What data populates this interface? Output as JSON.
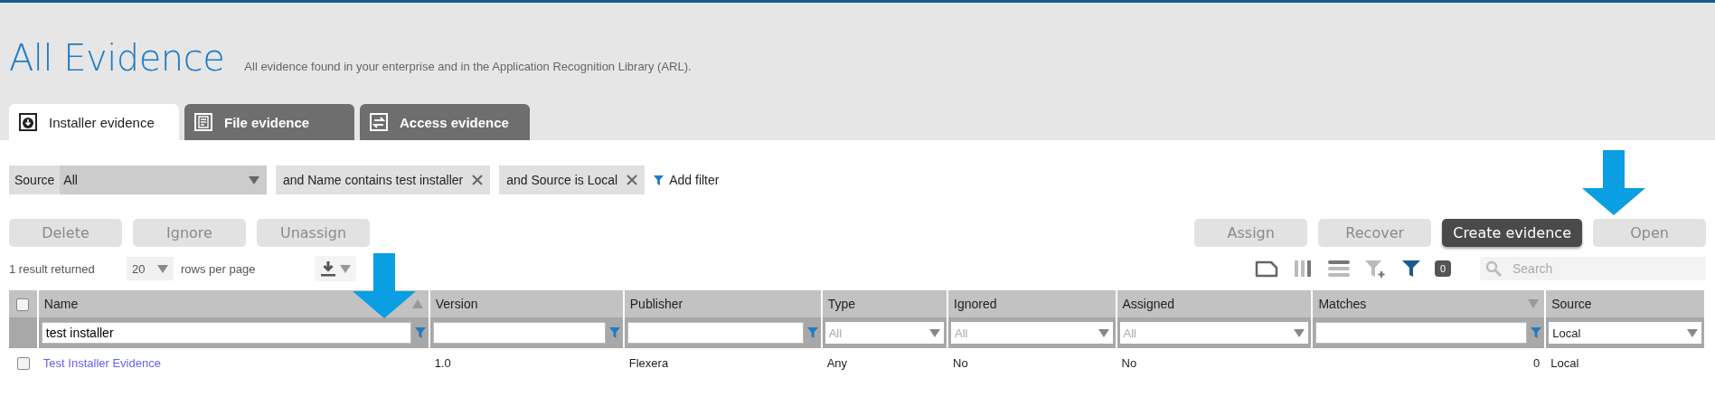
{
  "page": {
    "title": "All Evidence",
    "subtitle": "All evidence found in your enterprise and in the Application Recognition Library (ARL)."
  },
  "tabs": [
    {
      "label": "Installer evidence",
      "selected": true
    },
    {
      "label": "File evidence",
      "selected": false
    },
    {
      "label": "Access evidence",
      "selected": false
    }
  ],
  "filters": {
    "source_label": "Source",
    "source_value": "All",
    "chips": [
      "and Name contains test installer",
      "and Source is Local"
    ],
    "add_filter": "Add filter"
  },
  "actions_left": [
    {
      "label": "Delete",
      "disabled": true
    },
    {
      "label": "Ignore",
      "disabled": true
    },
    {
      "label": "Unassign",
      "disabled": true
    }
  ],
  "actions_right": [
    {
      "label": "Assign",
      "disabled": true
    },
    {
      "label": "Recover",
      "disabled": true
    },
    {
      "label": "Create evidence",
      "disabled": false
    },
    {
      "label": "Open",
      "disabled": true
    }
  ],
  "results": {
    "count_text": "1 result returned",
    "page_size": "20",
    "rows_per_page": "rows per page"
  },
  "toolbar": {
    "badge": "0",
    "search_placeholder": "Search"
  },
  "table": {
    "header_checked": false,
    "columns": [
      {
        "label": "Name",
        "sort_up": true,
        "filter": {
          "kind": "text",
          "value": "test installer"
        }
      },
      {
        "label": "Version",
        "filter": {
          "kind": "text"
        }
      },
      {
        "label": "Publisher",
        "filter": {
          "kind": "text"
        }
      },
      {
        "label": "Type",
        "filter": {
          "kind": "select",
          "placeholder": "All"
        }
      },
      {
        "label": "Ignored",
        "filter": {
          "kind": "select",
          "placeholder": "All"
        }
      },
      {
        "label": "Assigned",
        "filter": {
          "kind": "select",
          "placeholder": "All"
        }
      },
      {
        "label": "Matches",
        "sort_up": false,
        "filter": {
          "kind": "text"
        }
      },
      {
        "label": "Source",
        "filter": {
          "kind": "select",
          "value": "Local"
        }
      }
    ],
    "rows": [
      {
        "checked": false,
        "cells": [
          {
            "kind": "link",
            "text": "Test Installer Evidence"
          },
          {
            "kind": "text",
            "text": "1.0"
          },
          {
            "kind": "text",
            "text": "Flexera"
          },
          {
            "kind": "text",
            "text": "Any"
          },
          {
            "kind": "text",
            "text": "No"
          },
          {
            "kind": "text",
            "text": "No"
          },
          {
            "kind": "number",
            "text": "0"
          },
          {
            "kind": "text",
            "text": "Local"
          }
        ]
      }
    ]
  }
}
